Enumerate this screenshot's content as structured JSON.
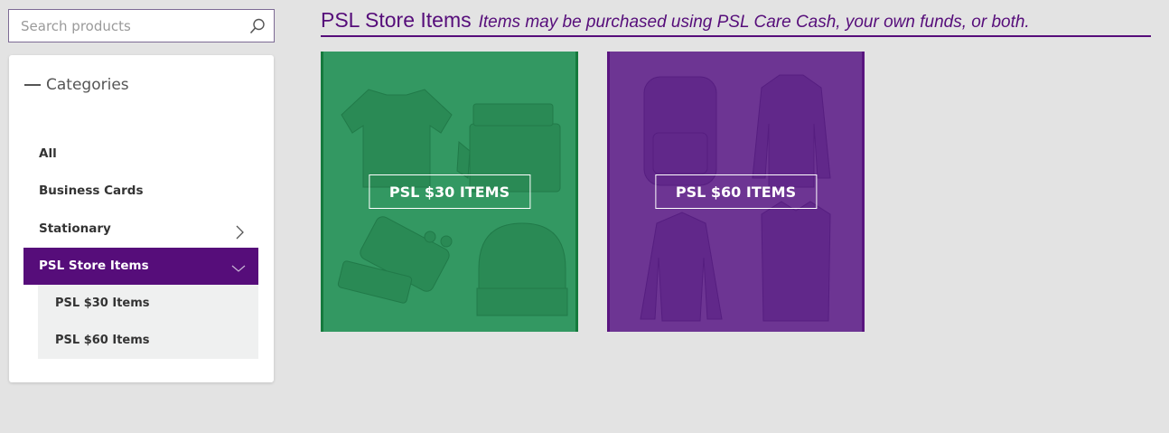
{
  "search": {
    "placeholder": "Search products",
    "icon": "search-icon"
  },
  "sidebar": {
    "heading": "Categories",
    "items": [
      {
        "label": "All"
      },
      {
        "label": "Business Cards"
      },
      {
        "label": "Stationary",
        "icon": "chevron-right-icon"
      },
      {
        "label": "PSL Store Items",
        "icon": "chevron-down-icon",
        "active": true
      }
    ],
    "subitems": [
      {
        "label": "PSL $30 Items"
      },
      {
        "label": "PSL $60 Items"
      }
    ]
  },
  "header": {
    "title": "PSL Store Items",
    "subtitle": "Items may be purchased using PSL Care Cash, your own funds, or both."
  },
  "tiles": [
    {
      "label": "PSL $30 ITEMS",
      "color": "#339862"
    },
    {
      "label": "PSL $60 ITEMS",
      "color": "#6d3593"
    }
  ],
  "colors": {
    "accent": "#560d7a",
    "search_border": "#7d6b95"
  }
}
